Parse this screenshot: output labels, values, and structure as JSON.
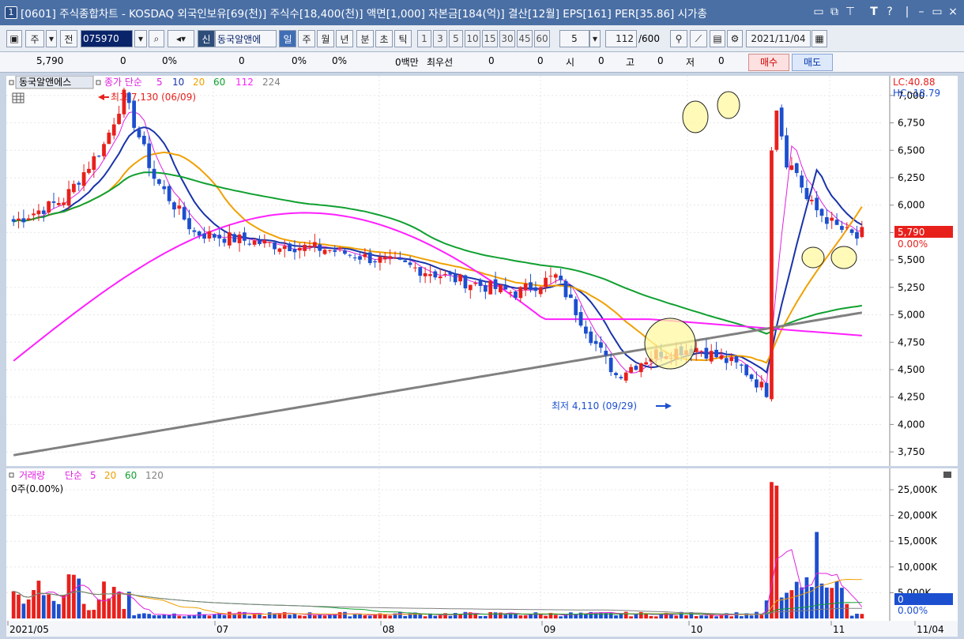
{
  "window": {
    "number": "1",
    "title": "[0601] 주식종합차트 - KOSDAQ 외국인보유[69(천)] 주식수[18,400(천)] 액면[1,000] 자본금[184(억)] 결산[12월] EPS[161] PER[35.86] 시가총",
    "icons": [
      "layout-icon",
      "copy-icon",
      "pin-icon",
      "font-icon",
      "help-icon",
      "minimize-icon",
      "maximize-icon",
      "close-icon"
    ]
  },
  "toolbar": {
    "type_label": "주",
    "prev_label": "전",
    "code_value": "075970",
    "new_badge": "신",
    "stock_name": "동국알앤에",
    "periods": [
      "일",
      "주",
      "월",
      "년",
      "분",
      "초",
      "틱"
    ],
    "active_period": "일",
    "intervals": [
      "1",
      "3",
      "5",
      "10",
      "15",
      "30",
      "45",
      "60"
    ],
    "interval_value": "5",
    "count_value": "112",
    "count_total": "/600",
    "date_value": "2021/11/04"
  },
  "infobar": {
    "price": "5,790",
    "change": "0",
    "change_pct": "0%",
    "volume": "0",
    "vol_pct": "0%",
    "turnover_pct": "0%",
    "amount": "0백만",
    "pref_label": "최우선",
    "pref_1": "0",
    "pref_2": "0",
    "open_label": "시",
    "open_value": "0",
    "high_label": "고",
    "high_value": "0",
    "low_label": "저",
    "low_value": "0",
    "buy_label": "매수",
    "sell_label": "매도"
  },
  "price_panel": {
    "stock_label": "동국알앤에스",
    "ma_label": "종가 단순",
    "ma_periods": [
      "5",
      "10",
      "20",
      "60",
      "112",
      "224"
    ],
    "lc": "LC:40.88",
    "hc": "HC:-18.79",
    "current_tag": "5,790",
    "current_pct": "0.00%",
    "high_annotation": "최고 7,130 (06/09)",
    "low_annotation": "최저 4,110 (09/29)"
  },
  "volume_panel": {
    "label": "거래량",
    "ma_label": "단순",
    "ma_periods": [
      "5",
      "20",
      "60",
      "120"
    ],
    "current": "0주(0.00%)",
    "current_tag": "0",
    "current_pct": "0.00%"
  },
  "colors": {
    "up": "#e8201c",
    "down": "#1c4fcf",
    "ma5": "#e020e0",
    "ma10": "#1a33aa",
    "ma20": "#f0a000",
    "ma60": "#10a030",
    "ma112": "#ff20ff",
    "ma224": "#808080"
  },
  "chart_data": {
    "type": "candlestick",
    "y_ticks": [
      "7,000",
      "6,750",
      "6,500",
      "6,250",
      "6,000",
      "5,750",
      "5,500",
      "5,250",
      "5,000",
      "4,750",
      "4,500",
      "4,250",
      "4,000",
      "3,750"
    ],
    "ylim": [
      3650,
      7150
    ],
    "x_labels": [
      "2021/05",
      "07",
      "08",
      "09",
      "10",
      "11",
      "11/04"
    ],
    "volume_ticks": [
      "25,000K",
      "20,000K",
      "15,000K",
      "10,000K",
      "5,000K"
    ],
    "volume_max": 27000,
    "high": 7130,
    "low": 4110,
    "last_close": 5790
  }
}
